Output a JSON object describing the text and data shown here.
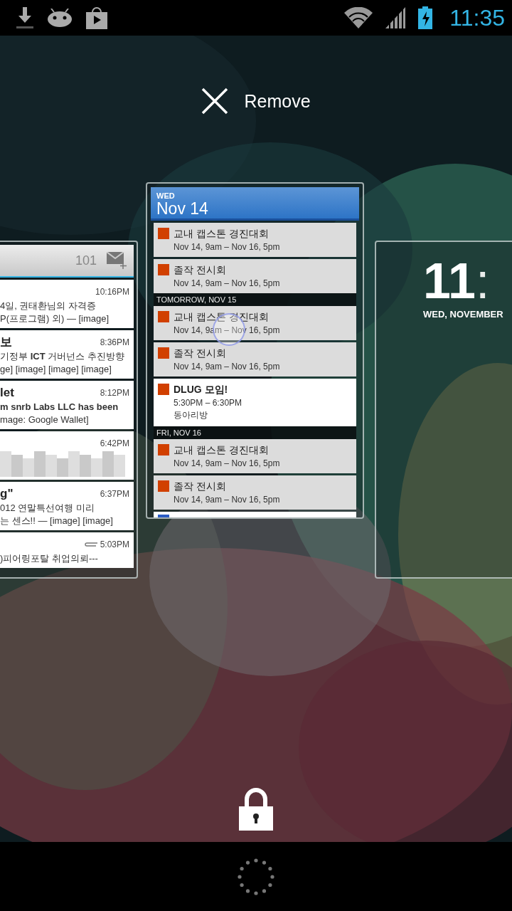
{
  "status_bar": {
    "time": "11:35"
  },
  "remove_label": "Remove",
  "email_widget": {
    "unread_count": "101",
    "messages": [
      {
        "kind": "plain",
        "time": "10:16PM",
        "lines": [
          "4일, 권태환님의 자격증",
          "P(프로그램) 외) — [image]"
        ]
      },
      {
        "kind": "plain",
        "sender": "보",
        "time": "8:36PM",
        "lines": [
          "기정부 **ICT** 거버넌스 추진방향",
          "ge] [image] [image] [image]"
        ]
      },
      {
        "kind": "plain",
        "sender": "let",
        "time": "8:12PM",
        "lines": [
          "**m snrb Labs LLC has been**",
          "mage: Google Wallet]"
        ]
      },
      {
        "kind": "blurred",
        "time": "6:42PM"
      },
      {
        "kind": "plain",
        "sender": "g\"",
        "time": "6:37PM",
        "lines": [
          "012 연말특선여행 미리",
          "는 센스!! — [image] [image]"
        ]
      },
      {
        "kind": "attachment",
        "time": "5:03PM",
        "lines": [
          ")피어링포탈 취업의뢰---"
        ]
      }
    ]
  },
  "calendar_widget": {
    "day": "WED",
    "date": "Nov 14",
    "items": [
      {
        "kind": "event",
        "title": "교내 캡스톤 경진대회",
        "lines": [
          "Nov 14, 9am – Nov 16, 5pm"
        ],
        "color": "#d14000",
        "highlighted": false
      },
      {
        "kind": "event",
        "title": "졸작 전시회",
        "lines": [
          "Nov 14, 9am – Nov 16, 5pm"
        ],
        "color": "#d14000",
        "highlighted": false
      },
      {
        "kind": "header",
        "title": "TOMORROW, NOV 15"
      },
      {
        "kind": "event",
        "title": "교내 캡스톤 경진대회",
        "lines": [
          "Nov 14, 9am – Nov 16, 5pm"
        ],
        "color": "#d14000",
        "highlighted": false
      },
      {
        "kind": "event",
        "title": "졸작 전시회",
        "lines": [
          "Nov 14, 9am – Nov 16, 5pm"
        ],
        "color": "#d14000",
        "highlighted": false
      },
      {
        "kind": "event",
        "title": "DLUG 모임!",
        "lines": [
          "5:30PM – 6:30PM",
          "동아리방"
        ],
        "color": "#d14000",
        "highlighted": true
      },
      {
        "kind": "header",
        "title": "FRI, NOV 16"
      },
      {
        "kind": "event",
        "title": "교내 캡스톤 경진대회",
        "lines": [
          "Nov 14, 9am – Nov 16, 5pm"
        ],
        "color": "#d14000",
        "highlighted": false
      },
      {
        "kind": "event",
        "title": "졸작 전시회",
        "lines": [
          "Nov 14, 9am – Nov 16, 5pm"
        ],
        "color": "#d14000",
        "highlighted": false
      },
      {
        "kind": "cut",
        "color": "#2b5cc4"
      }
    ]
  },
  "clock_widget": {
    "hours": "11",
    "minutes": ":",
    "date": "WED, NOVEMBER"
  }
}
